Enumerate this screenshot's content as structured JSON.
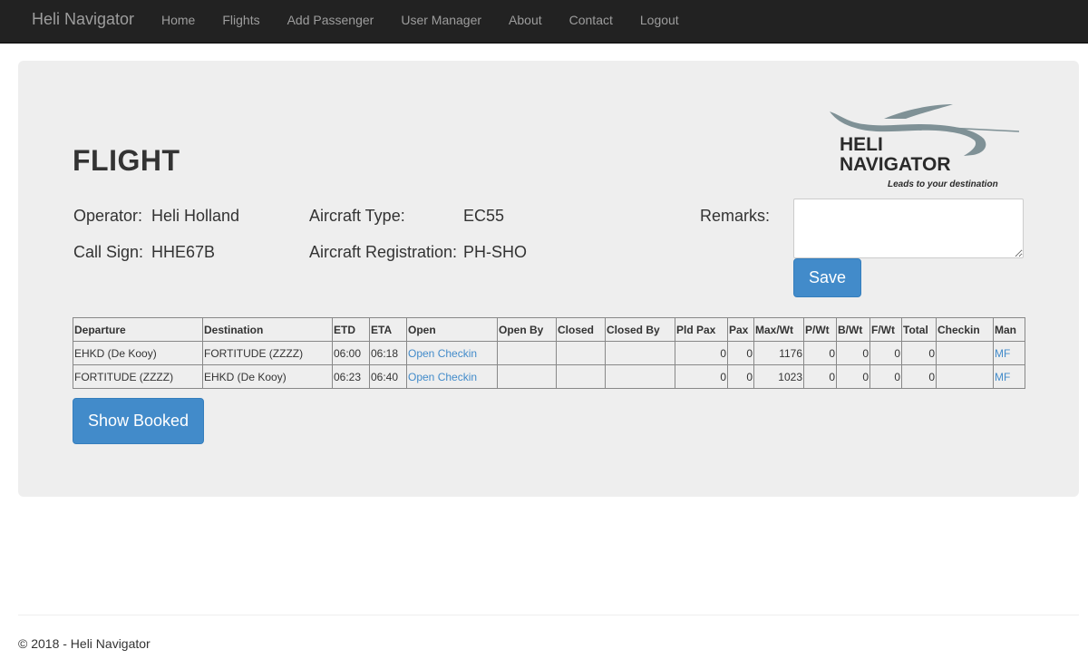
{
  "navbar": {
    "brand": "Heli Navigator",
    "items": [
      "Home",
      "Flights",
      "Add Passenger",
      "User Manager",
      "About",
      "Contact",
      "Logout"
    ]
  },
  "logo": {
    "line1": "HELI",
    "line2": "NAVIGATOR",
    "tagline": "Leads to your destination"
  },
  "flight": {
    "title": "FLIGHT",
    "operator_label": "Operator:",
    "operator": "Heli Holland",
    "callsign_label": "Call Sign:",
    "callsign": "HHE67B",
    "aircraft_type_label": "Aircraft Type:",
    "aircraft_type": "EC55",
    "aircraft_reg_label": "Aircraft Registration:",
    "aircraft_reg": "PH-SHO",
    "remarks_label": "Remarks:",
    "remarks_value": "",
    "save_label": "Save",
    "show_booked_label": "Show Booked"
  },
  "table": {
    "headers": [
      "Departure",
      "Destination",
      "ETD",
      "ETA",
      "Open",
      "Open By",
      "Closed",
      "Closed By",
      "Pld Pax",
      "Pax",
      "Max/Wt",
      "P/Wt",
      "B/Wt",
      "F/Wt",
      "Total",
      "Checkin",
      "Man"
    ],
    "rows": [
      {
        "departure": "EHKD (De Kooy)",
        "destination": "FORTITUDE (ZZZZ)",
        "etd": "06:00",
        "eta": "06:18",
        "open": "Open Checkin",
        "open_by": "",
        "closed": "",
        "closed_by": "",
        "pld_pax": "0",
        "pax": "0",
        "max_wt": "1176",
        "p_wt": "0",
        "b_wt": "0",
        "f_wt": "0",
        "total": "0",
        "checkin": "",
        "man": "MF"
      },
      {
        "departure": "FORTITUDE (ZZZZ)",
        "destination": "EHKD (De Kooy)",
        "etd": "06:23",
        "eta": "06:40",
        "open": "Open Checkin",
        "open_by": "",
        "closed": "",
        "closed_by": "",
        "pld_pax": "0",
        "pax": "0",
        "max_wt": "1023",
        "p_wt": "0",
        "b_wt": "0",
        "f_wt": "0",
        "total": "0",
        "checkin": "",
        "man": "MF"
      }
    ]
  },
  "footer": {
    "text": "© 2018 - Heli Navigator"
  },
  "colors": {
    "navbar_bg": "#222222",
    "link": "#428bca",
    "button": "#428bca",
    "jumbotron": "#eeeeee"
  }
}
